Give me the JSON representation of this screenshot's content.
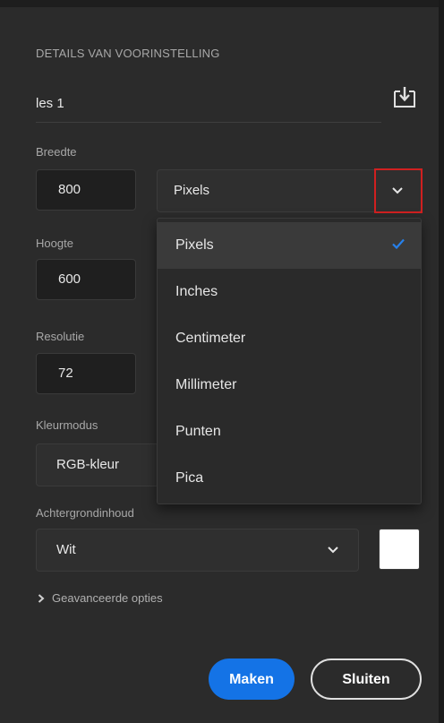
{
  "preset_details": {
    "section_title": "DETAILS VAN VOORINSTELLING",
    "preset_name": "les 1",
    "save_icon": "save-preset-icon"
  },
  "width": {
    "label": "Breedte",
    "value": "800"
  },
  "unit_select": {
    "selected": "Pixels",
    "icon": "chevron-down-icon"
  },
  "unit_dropdown": {
    "options": [
      "Pixels",
      "Inches",
      "Centimeter",
      "Millimeter",
      "Punten",
      "Pica"
    ],
    "selected_index": 0,
    "check_icon": "checkmark-icon",
    "check_color": "#2680eb"
  },
  "height": {
    "label": "Hoogte",
    "value": "600"
  },
  "resolution": {
    "label": "Resolutie",
    "value": "72"
  },
  "color_mode": {
    "label": "Kleurmodus",
    "value": "RGB-kleur"
  },
  "background": {
    "label": "Achtergrondinhoud",
    "value": "Wit",
    "swatch_color": "#ffffff"
  },
  "advanced": {
    "label": "Geavanceerde opties",
    "icon": "chevron-right-icon"
  },
  "actions": {
    "create_label": "Maken",
    "close_label": "Sluiten",
    "create_color": "#1473e6"
  }
}
